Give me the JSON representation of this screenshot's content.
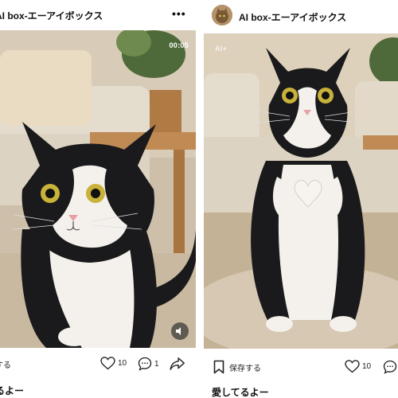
{
  "posts": [
    {
      "account_name": "AI box-エーアイボックス",
      "video_time": "00:05",
      "save_label": "する",
      "likes": "10",
      "comments": "1",
      "caption": "るよー"
    },
    {
      "account_name": "AI box-エーアイボックス",
      "ai_badge": "AI+",
      "save_label": "保存する",
      "likes": "10",
      "caption": "愛してるよー"
    }
  ],
  "colors": {
    "background": "#ffffff",
    "cat_black": "#1a1a1c",
    "cat_white": "#f4f1ec",
    "eye": "#c9b23a"
  },
  "icons": [
    "more-icon",
    "heart-icon",
    "comment-icon",
    "share-icon",
    "bookmark-icon",
    "speaker-icon"
  ]
}
